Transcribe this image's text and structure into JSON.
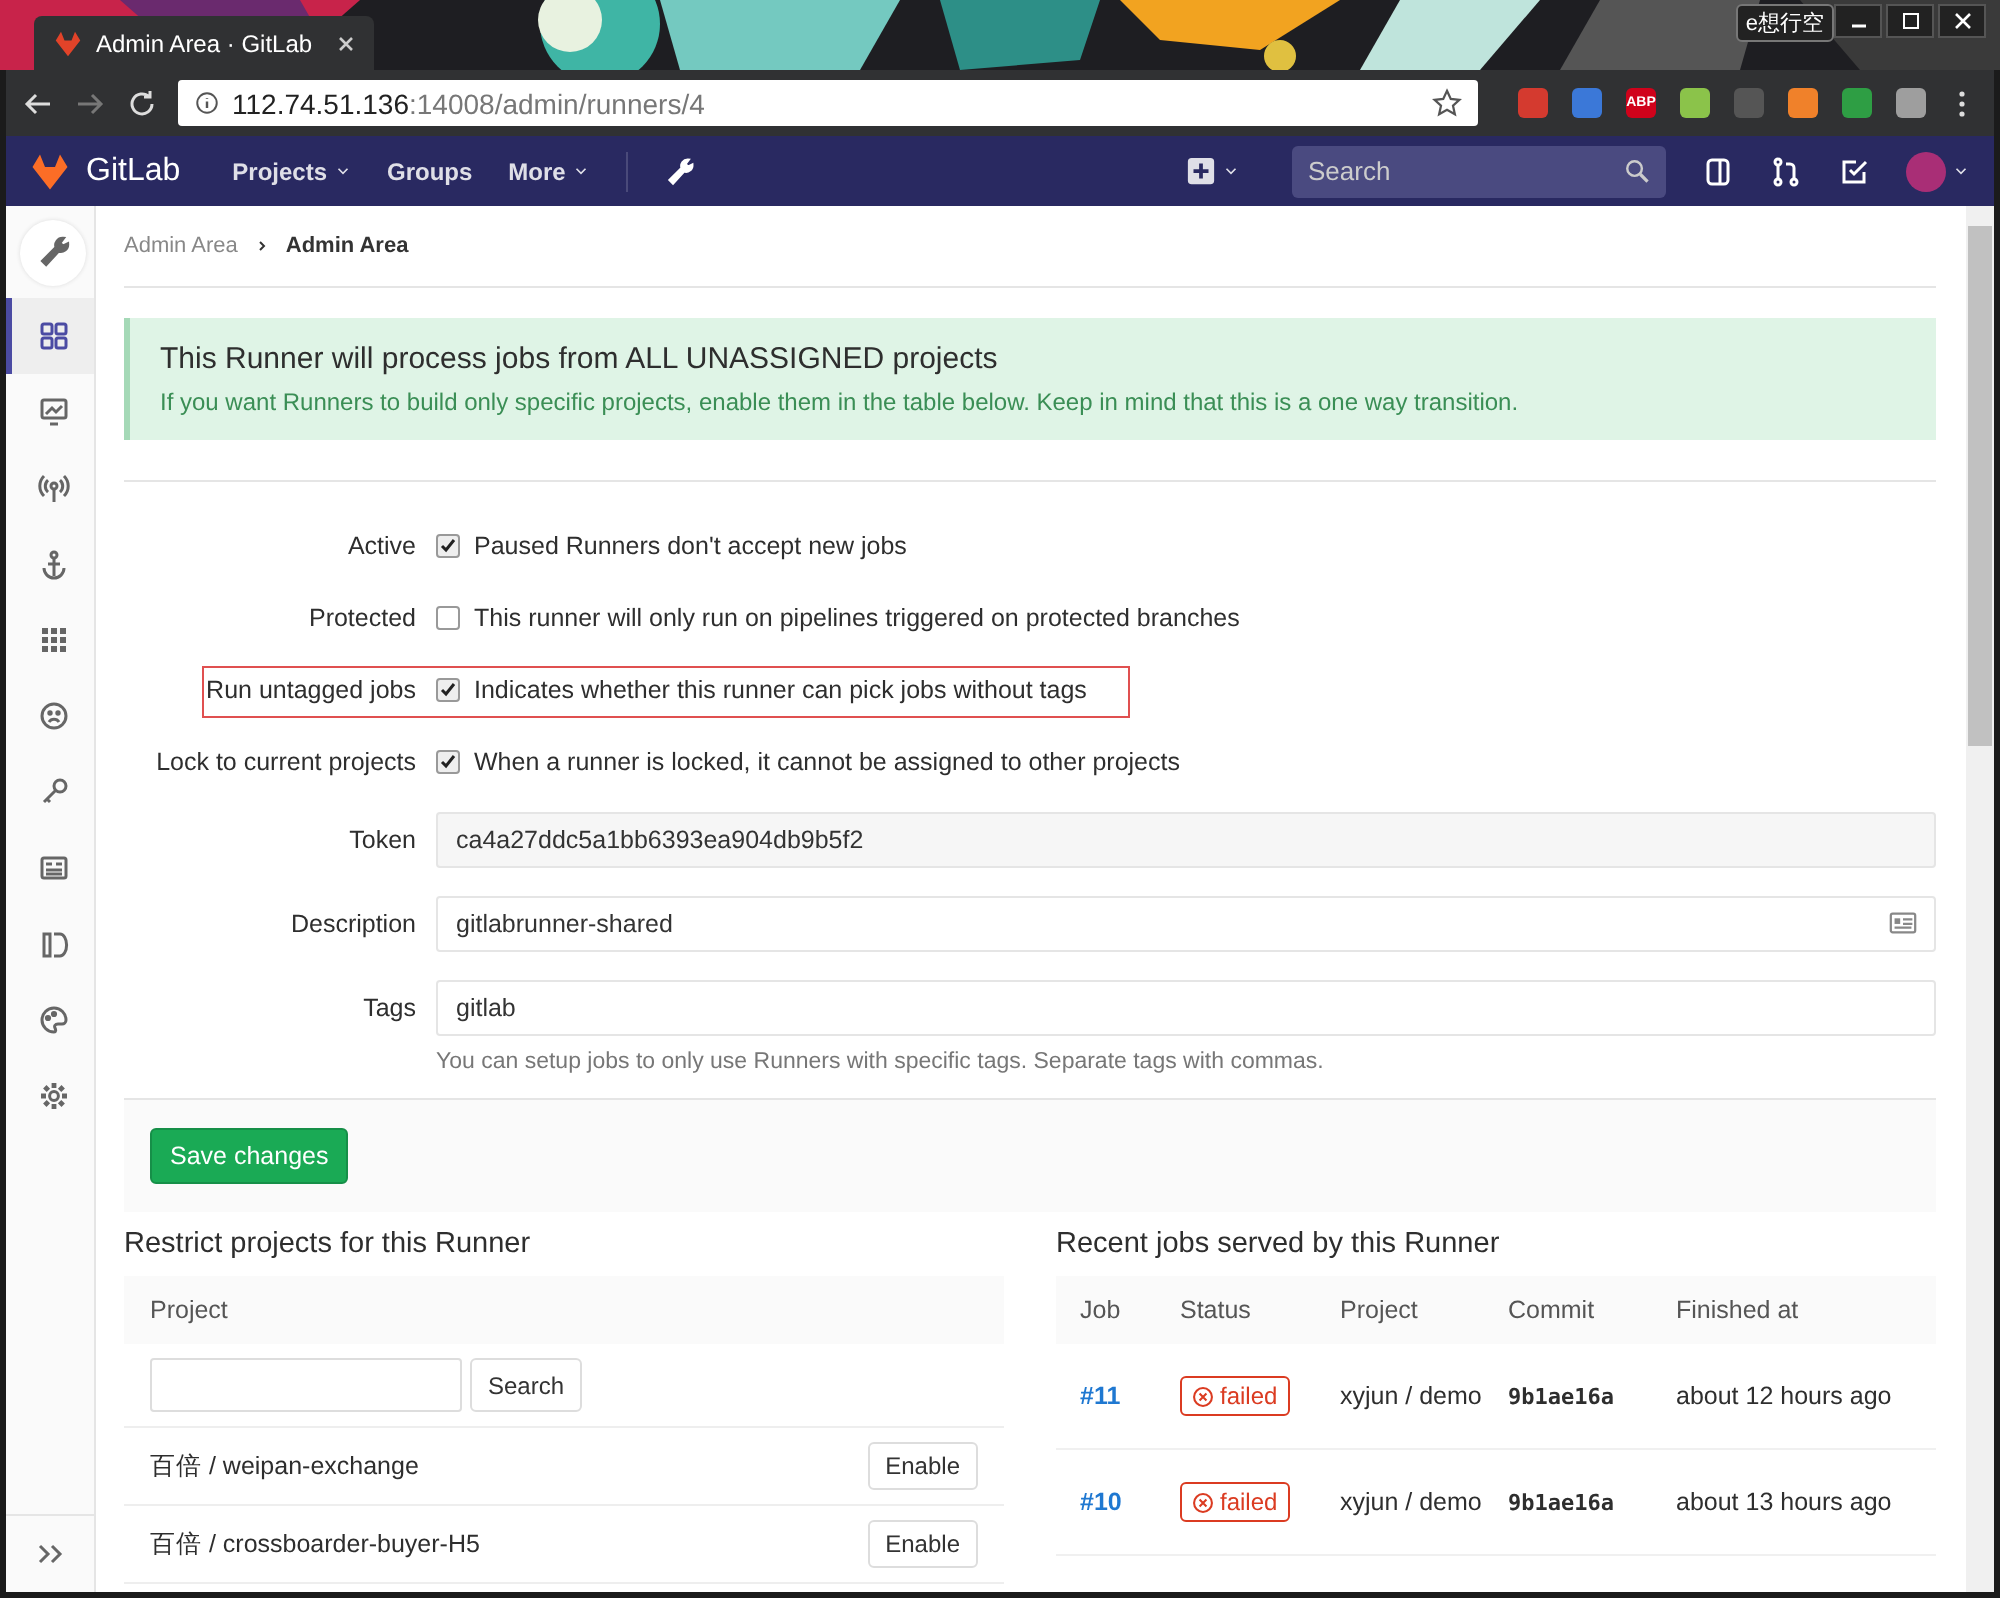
{
  "desktop": {
    "label": "e想行空"
  },
  "browser": {
    "tab_title": "Admin Area · GitLab",
    "url_host": "112.74.51.136",
    "url_rest": ":14008/admin/runners/4",
    "extensions": [
      {
        "color": "#d43a2f"
      },
      {
        "color": "#3b78d8"
      },
      {
        "color": "#d0021b",
        "label": "ABP"
      },
      {
        "color": "#8bc34a"
      },
      {
        "color": "#555555"
      },
      {
        "color": "#f0812a"
      },
      {
        "color": "#2e9e44"
      },
      {
        "color": "#9e9e9e"
      }
    ]
  },
  "navbar": {
    "brand": "GitLab",
    "links": [
      {
        "label": "Projects",
        "dropdown": true
      },
      {
        "label": "Groups",
        "dropdown": false
      },
      {
        "label": "More",
        "dropdown": true
      }
    ],
    "search": {
      "placeholder": "Search"
    }
  },
  "sidebar": {
    "items": [
      {
        "selected": false
      },
      {
        "selected": true
      },
      {
        "selected": false
      },
      {
        "selected": false
      },
      {
        "selected": false
      },
      {
        "selected": false
      },
      {
        "selected": false
      },
      {
        "selected": false
      },
      {
        "selected": false
      },
      {
        "selected": false
      },
      {
        "selected": false
      },
      {
        "selected": false
      }
    ]
  },
  "breadcrumbs": [
    "Admin Area",
    "Admin Area"
  ],
  "alert": {
    "title": "This Runner will process jobs from ALL UNASSIGNED projects",
    "text": "If you want Runners to build only specific projects, enable them in the table below. Keep in mind that this is a one way transition."
  },
  "settings": [
    {
      "kind": "checkbox",
      "label": "Active",
      "checked": true,
      "text": "Paused Runners don't accept new jobs",
      "highlighted": false
    },
    {
      "kind": "checkbox",
      "label": "Protected",
      "checked": false,
      "text": "This runner will only run on pipelines triggered on protected branches",
      "highlighted": false
    },
    {
      "kind": "checkbox",
      "label": "Run untagged jobs",
      "checked": true,
      "text": "Indicates whether this runner can pick jobs without tags",
      "highlighted": true
    },
    {
      "kind": "checkbox",
      "label": "Lock to current projects",
      "checked": true,
      "text": "When a runner is locked, it cannot be assigned to other projects",
      "highlighted": false
    },
    {
      "kind": "readonly",
      "label": "Token",
      "value": "ca4a27ddc5a1bb6393ea904db9b5f2"
    },
    {
      "kind": "field",
      "label": "Description",
      "value": "gitlabrunner-shared",
      "icon": true
    },
    {
      "kind": "field",
      "label": "Tags",
      "value": "gitlab",
      "help": "You can setup jobs to only use Runners with specific tags. Separate tags with commas."
    }
  ],
  "save_button": "Save changes",
  "restrict": {
    "title": "Restrict projects for this Runner",
    "column": "Project",
    "search_button": "Search",
    "projects": [
      {
        "name": "百倍 / weipan-exchange",
        "action": "Enable"
      },
      {
        "name": "百倍 / crossboarder-buyer-H5",
        "action": "Enable"
      }
    ]
  },
  "jobs": {
    "title": "Recent jobs served by this Runner",
    "columns": [
      "Job",
      "Status",
      "Project",
      "Commit",
      "Finished at"
    ],
    "rows": [
      {
        "job": "#11",
        "status": "failed",
        "project": "xyjun / demo",
        "commit": "9b1ae16a",
        "finished": "about 12 hours ago"
      },
      {
        "job": "#10",
        "status": "failed",
        "project": "xyjun / demo",
        "commit": "9b1ae16a",
        "finished": "about 13 hours ago"
      }
    ]
  }
}
